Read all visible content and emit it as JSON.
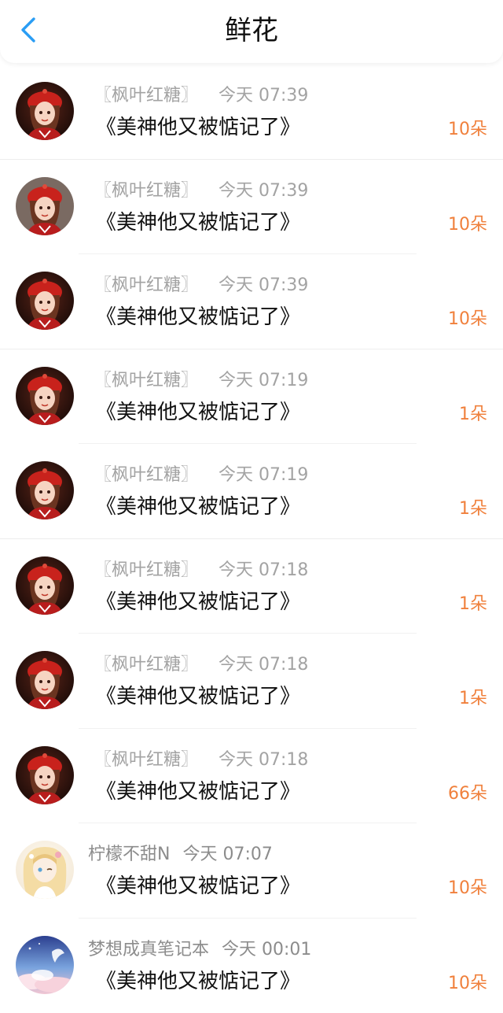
{
  "header": {
    "title": "鲜花",
    "back_icon": "chevron-left-icon",
    "accent_color": "#2a9df4"
  },
  "gifts": [
    {
      "user": "〖枫叶红糖〗",
      "time": "今天 07:39",
      "book": "《美神他又被惦记了》",
      "amount": "10朵",
      "avatar": "red-beret-girl"
    },
    {
      "user": "〖枫叶红糖〗",
      "time": "今天 07:39",
      "book": "《美神他又被惦记了》",
      "amount": "10朵",
      "avatar": "red-beret-girl"
    },
    {
      "user": "〖枫叶红糖〗",
      "time": "今天 07:39",
      "book": "《美神他又被惦记了》",
      "amount": "10朵",
      "avatar": "red-beret-girl"
    },
    {
      "user": "〖枫叶红糖〗",
      "time": "今天 07:19",
      "book": "《美神他又被惦记了》",
      "amount": "1朵",
      "avatar": "red-beret-girl"
    },
    {
      "user": "〖枫叶红糖〗",
      "time": "今天 07:19",
      "book": "《美神他又被惦记了》",
      "amount": "1朵",
      "avatar": "red-beret-girl"
    },
    {
      "user": "〖枫叶红糖〗",
      "time": "今天 07:18",
      "book": "《美神他又被惦记了》",
      "amount": "1朵",
      "avatar": "red-beret-girl"
    },
    {
      "user": "〖枫叶红糖〗",
      "time": "今天 07:18",
      "book": "《美神他又被惦记了》",
      "amount": "1朵",
      "avatar": "red-beret-girl"
    },
    {
      "user": "〖枫叶红糖〗",
      "time": "今天 07:18",
      "book": "《美神他又被惦记了》",
      "amount": "66朵",
      "avatar": "red-beret-girl"
    },
    {
      "user": "柠檬不甜N",
      "time": "今天 07:07",
      "book": "《美神他又被惦记了》",
      "amount": "10朵",
      "avatar": "blonde-anime-girl"
    },
    {
      "user": "梦想成真笔记本",
      "time": "今天 00:01",
      "book": "《美神他又被惦记了》",
      "amount": "10朵",
      "avatar": "sky-clouds"
    }
  ],
  "colors": {
    "amount": "#f0803c",
    "meta_text": "#a3a3a3",
    "title_text": "#111111"
  }
}
